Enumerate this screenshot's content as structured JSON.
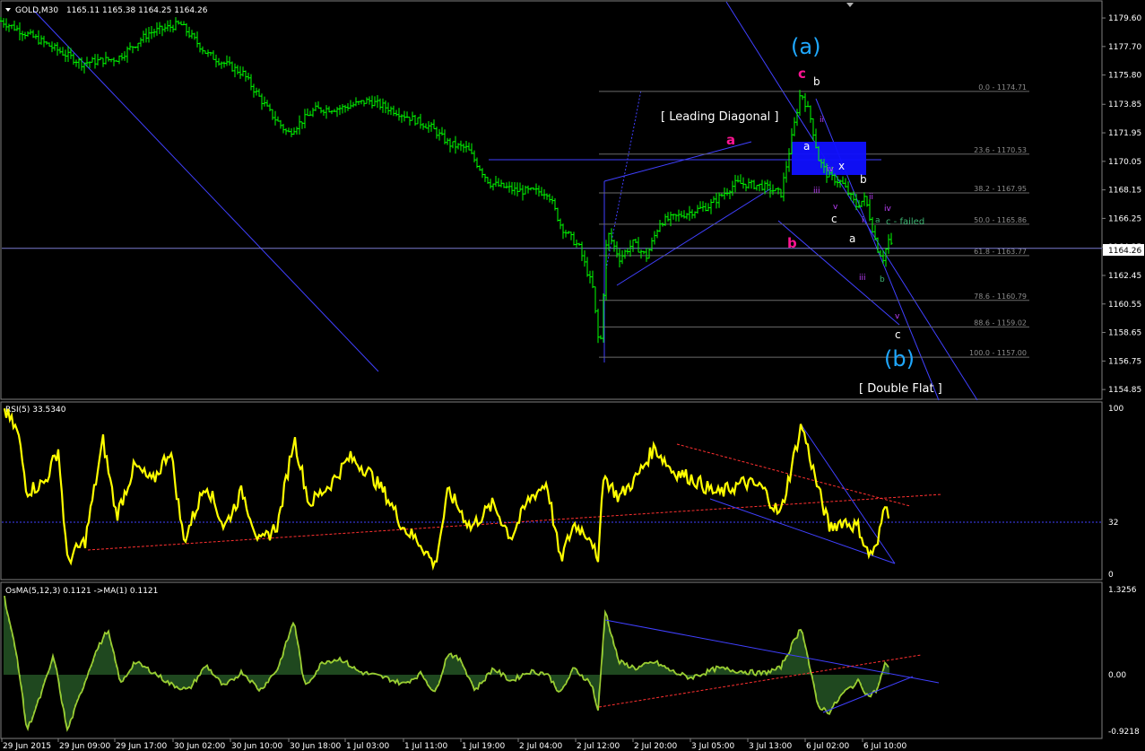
{
  "window": {
    "symbol_timeframe": "GOLD,M30",
    "ohlc": "1165.11 1165.38 1164.25 1164.26"
  },
  "price_panel": {
    "price_labels": [
      "1179.60",
      "1177.70",
      "1175.80",
      "1173.85",
      "1171.95",
      "1170.05",
      "1168.15",
      "1166.25",
      "1164.35",
      "1162.45",
      "1160.55",
      "1158.65",
      "1156.75",
      "1154.85"
    ],
    "current_price": "1164.26",
    "current_price_value": 1164.26,
    "ylim": [
      1154.5,
      1180.2
    ]
  },
  "fib_levels": [
    {
      "label": "0.0 - 1174.71",
      "value": 1174.71
    },
    {
      "label": "23.6 - 1170.53",
      "value": 1170.53
    },
    {
      "label": "38.2 - 1167.95",
      "value": 1167.95
    },
    {
      "label": "50.0 - 1165.86",
      "value": 1165.86
    },
    {
      "label": "61.8 - 1163.77",
      "value": 1163.77
    },
    {
      "label": "78.6 - 1160.79",
      "value": 1160.79
    },
    {
      "label": "88.6 - 1159.02",
      "value": 1159.02
    },
    {
      "label": "100.0 - 1157.00",
      "value": 1157.0
    }
  ],
  "annotations": {
    "wave_a_big": "(a)",
    "wave_b_big": "(b)",
    "leading_diagonal": "[ Leading Diagonal ]",
    "double_flat": "[ Double Flat ]",
    "c_failed": "c - failed",
    "pink_a": "a",
    "pink_b": "b",
    "pink_c": "c",
    "w_b1": "b",
    "w_a1": "a",
    "w_x": "x",
    "w_b2": "b",
    "w_c1": "c",
    "w_a2": "a",
    "w_c2": "c",
    "m_ii1": "ii",
    "m_iv1": "iv",
    "m_iii1": "iii",
    "m_v1": "v",
    "m_i1": "i",
    "m_ii2": "ii",
    "m_iv2": "iv",
    "m_iii2": "iii",
    "m_v2": "v",
    "g_a": "a",
    "g_b": "b"
  },
  "rsi_panel": {
    "label": "RSI(5) 33.5340",
    "top_label": "100",
    "level_label": "32",
    "bottom_label": "0",
    "value": 33.534
  },
  "osma_panel": {
    "label": "OsMA(5,12,3) 0.1121  ->MA(1) 0.1121",
    "top_label": "1.3256",
    "mid_label": "0.00",
    "bottom_label": "-0.9218",
    "value": 0.1121
  },
  "time_axis": [
    "29 Jun 2015",
    "29 Jun 09:00",
    "29 Jun 17:00",
    "30 Jun 02:00",
    "30 Jun 10:00",
    "30 Jun 18:00",
    "1 Jul 03:00",
    "1 Jul 11:00",
    "1 Jul 19:00",
    "2 Jul 04:00",
    "2 Jul 12:00",
    "2 Jul 20:00",
    "3 Jul 05:00",
    "3 Jul 13:00",
    "6 Jul 02:00",
    "6 Jul 10:00"
  ],
  "chart_data": {
    "type": "line",
    "price_series": {
      "name": "GOLD,M30 close",
      "anchors": [
        [
          0,
          1179.4
        ],
        [
          40,
          1178.2
        ],
        [
          90,
          1176.6
        ],
        [
          130,
          1176.9
        ],
        [
          165,
          1178.6
        ],
        [
          200,
          1179.2
        ],
        [
          230,
          1177.2
        ],
        [
          270,
          1175.9
        ],
        [
          300,
          1173.3
        ],
        [
          320,
          1171.9
        ],
        [
          350,
          1173.5
        ],
        [
          380,
          1173.6
        ],
        [
          410,
          1174.1
        ],
        [
          440,
          1173.4
        ],
        [
          480,
          1172.3
        ],
        [
          500,
          1171.2
        ],
        [
          520,
          1170.9
        ],
        [
          545,
          1168.6
        ],
        [
          575,
          1168.1
        ],
        [
          610,
          1168.0
        ],
        [
          625,
          1165.7
        ],
        [
          645,
          1164.3
        ],
        [
          660,
          1161.6
        ],
        [
          668,
          1157.2
        ],
        [
          676,
          1165.4
        ],
        [
          690,
          1163.6
        ],
        [
          705,
          1164.6
        ],
        [
          720,
          1163.7
        ],
        [
          735,
          1166.0
        ],
        [
          760,
          1166.5
        ],
        [
          790,
          1167.1
        ],
        [
          820,
          1168.6
        ],
        [
          850,
          1168.4
        ],
        [
          870,
          1167.9
        ],
        [
          892,
          1174.7
        ],
        [
          902,
          1173.2
        ],
        [
          912,
          1170.2
        ],
        [
          922,
          1169.1
        ],
        [
          938,
          1168.6
        ],
        [
          954,
          1167.1
        ],
        [
          964,
          1167.6
        ],
        [
          972,
          1165.6
        ],
        [
          978,
          1164.2
        ],
        [
          984,
          1163.6
        ],
        [
          990,
          1164.8
        ],
        [
          994,
          1164.3
        ]
      ]
    },
    "rsi_series": {
      "name": "RSI(5)",
      "anchors": [
        [
          5,
          98
        ],
        [
          20,
          85
        ],
        [
          30,
          50
        ],
        [
          50,
          55
        ],
        [
          65,
          75
        ],
        [
          75,
          8
        ],
        [
          95,
          20
        ],
        [
          115,
          80
        ],
        [
          130,
          35
        ],
        [
          150,
          65
        ],
        [
          170,
          55
        ],
        [
          190,
          75
        ],
        [
          205,
          20
        ],
        [
          230,
          55
        ],
        [
          250,
          28
        ],
        [
          270,
          50
        ],
        [
          290,
          18
        ],
        [
          310,
          30
        ],
        [
          328,
          82
        ],
        [
          345,
          42
        ],
        [
          370,
          55
        ],
        [
          390,
          70
        ],
        [
          410,
          62
        ],
        [
          430,
          48
        ],
        [
          450,
          28
        ],
        [
          470,
          18
        ],
        [
          485,
          5
        ],
        [
          500,
          50
        ],
        [
          525,
          28
        ],
        [
          550,
          42
        ],
        [
          570,
          22
        ],
        [
          590,
          45
        ],
        [
          610,
          55
        ],
        [
          625,
          8
        ],
        [
          640,
          30
        ],
        [
          660,
          22
        ],
        [
          667,
          3
        ],
        [
          672,
          60
        ],
        [
          690,
          46
        ],
        [
          710,
          58
        ],
        [
          730,
          76
        ],
        [
          750,
          62
        ],
        [
          770,
          58
        ],
        [
          800,
          48
        ],
        [
          830,
          55
        ],
        [
          850,
          52
        ],
        [
          870,
          35
        ],
        [
          894,
          90
        ],
        [
          912,
          52
        ],
        [
          925,
          28
        ],
        [
          940,
          32
        ],
        [
          958,
          28
        ],
        [
          968,
          12
        ],
        [
          978,
          15
        ],
        [
          988,
          47
        ],
        [
          992,
          34
        ]
      ]
    },
    "osma_series": {
      "name": "OsMA(5,12,3)",
      "anchors": [
        [
          5,
          1.2
        ],
        [
          20,
          0.2
        ],
        [
          30,
          -0.9
        ],
        [
          45,
          -0.35
        ],
        [
          60,
          0.3
        ],
        [
          75,
          -0.9
        ],
        [
          95,
          -0.1
        ],
        [
          105,
          0.3
        ],
        [
          120,
          0.7
        ],
        [
          135,
          -0.15
        ],
        [
          150,
          0.2
        ],
        [
          170,
          0.05
        ],
        [
          190,
          -0.15
        ],
        [
          210,
          -0.25
        ],
        [
          230,
          0.15
        ],
        [
          250,
          -0.2
        ],
        [
          270,
          0.05
        ],
        [
          290,
          -0.25
        ],
        [
          310,
          0.1
        ],
        [
          328,
          0.85
        ],
        [
          340,
          -0.2
        ],
        [
          360,
          0.2
        ],
        [
          380,
          0.25
        ],
        [
          400,
          0.05
        ],
        [
          430,
          -0.05
        ],
        [
          450,
          -0.15
        ],
        [
          470,
          0.02
        ],
        [
          485,
          -0.3
        ],
        [
          500,
          0.35
        ],
        [
          515,
          0.2
        ],
        [
          530,
          -0.25
        ],
        [
          550,
          0.1
        ],
        [
          570,
          -0.1
        ],
        [
          590,
          0.05
        ],
        [
          610,
          0.02
        ],
        [
          625,
          -0.3
        ],
        [
          640,
          0.1
        ],
        [
          660,
          -0.15
        ],
        [
          667,
          -0.6
        ],
        [
          675,
          1.0
        ],
        [
          690,
          0.2
        ],
        [
          710,
          0.1
        ],
        [
          730,
          0.2
        ],
        [
          750,
          0.05
        ],
        [
          770,
          -0.05
        ],
        [
          800,
          0.1
        ],
        [
          830,
          0.05
        ],
        [
          850,
          0.02
        ],
        [
          870,
          0.1
        ],
        [
          894,
          0.75
        ],
        [
          912,
          -0.5
        ],
        [
          925,
          -0.6
        ],
        [
          940,
          -0.3
        ],
        [
          958,
          -0.1
        ],
        [
          968,
          -0.35
        ],
        [
          978,
          -0.25
        ],
        [
          988,
          0.2
        ],
        [
          992,
          0.11
        ]
      ]
    },
    "xlabel": "",
    "ylabel": "",
    "grid": false
  },
  "colors": {
    "background": "#000000",
    "candle": "#00ff00",
    "rsi": "#ffff00",
    "osma": "#9acd32",
    "trend": "#4040ff",
    "dotted_red": "#ff3030",
    "panel_border": "#808080",
    "fib": "#696969",
    "blue_box": "#1010ff",
    "cyan": "#1fa8ff",
    "pink": "#ff1493",
    "magenta": "#c040ff"
  }
}
